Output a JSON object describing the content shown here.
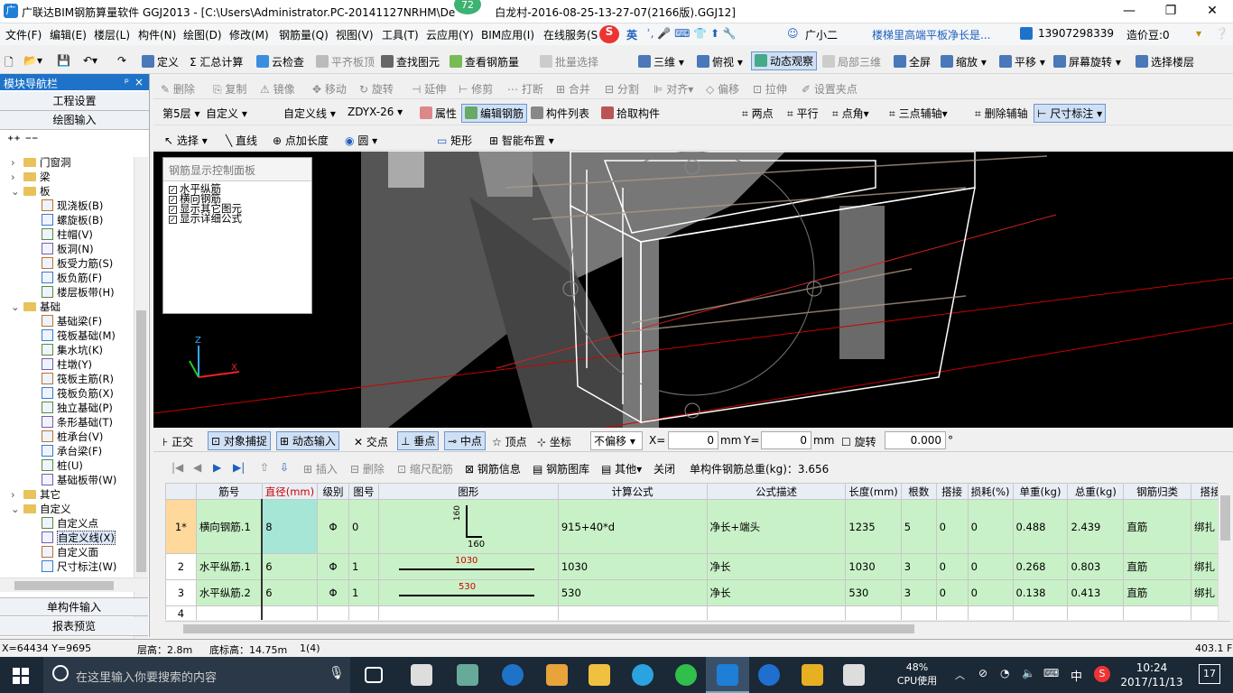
{
  "title": {
    "app": "广联达BIM钢筋算量软件 GGJ2013 - [C:\\Users\\Administrator.PC-20141127NRHM\\De",
    "file": "白龙村-2016-08-25-13-27-07(2166版).GGJ12]",
    "badge": "72"
  },
  "menu": [
    "文件(F)",
    "编辑(E)",
    "楼层(L)",
    "构件(N)",
    "绘图(D)",
    "修改(M)",
    "钢筋量(Q)",
    "视图(V)",
    "工具(T)",
    "云应用(Y)",
    "BIM应用(I)",
    "在线服务(S"
  ],
  "menu_right": {
    "ime": "英",
    "ime2": "广小二",
    "question": "楼梯里高端平板净长是...",
    "phone": "13907298339",
    "price": "造价豆:0"
  },
  "toolbar1": [
    "定义",
    "Σ 汇总计算",
    "云检查",
    "平齐板顶",
    "查找图元",
    "查看钢筋量",
    "批量选择",
    "三维",
    "俯视",
    "动态观察",
    "局部三维",
    "全屏",
    "缩放",
    "平移",
    "屏幕旋转",
    "选择楼层"
  ],
  "toolbar2": [
    "删除",
    "复制",
    "镜像",
    "移动",
    "旋转",
    "延伸",
    "修剪",
    "打断",
    "合并",
    "分割",
    "对齐",
    "偏移",
    "拉伸",
    "设置夹点"
  ],
  "toolbar3": {
    "floor": "第5层",
    "type": "自定义",
    "sub": "自定义线",
    "code": "ZDYX-26",
    "items": [
      "属性",
      "编辑钢筋",
      "构件列表",
      "拾取构件"
    ],
    "right": [
      "两点",
      "平行",
      "点角",
      "三点辅轴",
      "删除辅轴",
      "尺寸标注"
    ]
  },
  "toolbar4": [
    "选择",
    "直线",
    "点加长度",
    "圆",
    "矩形",
    "智能布置"
  ],
  "sidebar": {
    "header": "模块导航栏",
    "pin": "ᵖ",
    "close": "×",
    "btn1": "工程设置",
    "btn2": "绘图输入",
    "btn3": "单构件输入",
    "btn4": "报表预览"
  },
  "tree": [
    {
      "label": "门窗洞",
      "lvl": 1,
      "exp": "›"
    },
    {
      "label": "梁",
      "lvl": 1,
      "exp": "›"
    },
    {
      "label": "板",
      "lvl": 1,
      "exp": "⌄"
    },
    {
      "label": "现浇板(B)",
      "lvl": 2
    },
    {
      "label": "螺旋板(B)",
      "lvl": 2
    },
    {
      "label": "柱帽(V)",
      "lvl": 2
    },
    {
      "label": "板洞(N)",
      "lvl": 2
    },
    {
      "label": "板受力筋(S)",
      "lvl": 2
    },
    {
      "label": "板负筋(F)",
      "lvl": 2
    },
    {
      "label": "楼层板带(H)",
      "lvl": 2
    },
    {
      "label": "基础",
      "lvl": 1,
      "exp": "⌄"
    },
    {
      "label": "基础梁(F)",
      "lvl": 2
    },
    {
      "label": "筏板基础(M)",
      "lvl": 2
    },
    {
      "label": "集水坑(K)",
      "lvl": 2
    },
    {
      "label": "柱墩(Y)",
      "lvl": 2
    },
    {
      "label": "筏板主筋(R)",
      "lvl": 2
    },
    {
      "label": "筏板负筋(X)",
      "lvl": 2
    },
    {
      "label": "独立基础(P)",
      "lvl": 2
    },
    {
      "label": "条形基础(T)",
      "lvl": 2
    },
    {
      "label": "桩承台(V)",
      "lvl": 2
    },
    {
      "label": "承台梁(F)",
      "lvl": 2
    },
    {
      "label": "桩(U)",
      "lvl": 2
    },
    {
      "label": "基础板带(W)",
      "lvl": 2
    },
    {
      "label": "其它",
      "lvl": 1,
      "exp": "›"
    },
    {
      "label": "自定义",
      "lvl": 1,
      "exp": "⌄"
    },
    {
      "label": "自定义点",
      "lvl": 2
    },
    {
      "label": "自定义线(X)",
      "lvl": 2
    },
    {
      "label": "自定义面",
      "lvl": 2
    },
    {
      "label": "尺寸标注(W)",
      "lvl": 2
    }
  ],
  "panel": {
    "title": "钢筋显示控制面板",
    "opts": [
      "水平纵筋",
      "横向钢筋",
      "显示其它图元",
      "显示详细公式"
    ]
  },
  "snap": {
    "items": [
      "正交",
      "对象捕捉",
      "动态输入",
      "交点",
      "垂点",
      "中点",
      "顶点",
      "坐标"
    ],
    "offset": "不偏移",
    "x_label": "X=",
    "x": "0",
    "y_label": "Y=",
    "y": "0",
    "unit": "mm",
    "rotate": "旋转",
    "rot": "0.000",
    "deg": "°"
  },
  "gridbar": {
    "items": [
      "插入",
      "删除",
      "缩尺配筋",
      "钢筋信息",
      "钢筋图库",
      "其他",
      "关闭"
    ],
    "total": "单构件钢筋总重(kg)：3.656"
  },
  "table": {
    "headers": [
      "",
      "筋号",
      "直径(mm)",
      "级别",
      "图号",
      "图形",
      "计算公式",
      "公式描述",
      "长度(mm)",
      "根数",
      "搭接",
      "损耗(%)",
      "单重(kg)",
      "总重(kg)",
      "钢筋归类",
      "搭接"
    ],
    "rows": [
      {
        "no": "1*",
        "name": "横向钢筋.1",
        "d": "8",
        "grade": "Φ",
        "fig": "0",
        "shape": "160",
        "shape2": "160",
        "formula": "915+40*d",
        "desc": "净长+端头",
        "len": "1235",
        "n": "5",
        "lap": "0",
        "loss": "0",
        "uw": "0.488",
        "tw": "2.439",
        "cls": "直筋",
        "lt": "绑扎"
      },
      {
        "no": "2",
        "name": "水平纵筋.1",
        "d": "6",
        "grade": "Φ",
        "fig": "1",
        "shape": "1030",
        "formula": "1030",
        "desc": "净长",
        "len": "1030",
        "n": "3",
        "lap": "0",
        "loss": "0",
        "uw": "0.268",
        "tw": "0.803",
        "cls": "直筋",
        "lt": "绑扎"
      },
      {
        "no": "3",
        "name": "水平纵筋.2",
        "d": "6",
        "grade": "Φ",
        "fig": "1",
        "shape": "530",
        "formula": "530",
        "desc": "净长",
        "len": "530",
        "n": "3",
        "lap": "0",
        "loss": "0",
        "uw": "0.138",
        "tw": "0.413",
        "cls": "直筋",
        "lt": "绑扎"
      },
      {
        "no": "4",
        "name": "",
        "d": "",
        "grade": "",
        "fig": "",
        "shape": "",
        "formula": "",
        "desc": "",
        "len": "",
        "n": "",
        "lap": "",
        "loss": "",
        "uw": "",
        "tw": "",
        "cls": "",
        "lt": ""
      }
    ]
  },
  "status": {
    "coords": "X=64434 Y=9695",
    "floor_h": "层高：2.8m",
    "bottom": "底标高：14.75m",
    "page": "1(4)",
    "fps": "403.1 FPS"
  },
  "taskbar": {
    "search": "在这里输入你要搜索的内容",
    "cpu": "48%",
    "cpu_label": "CPU使用",
    "ime": "中",
    "time": "10:24",
    "date": "2017/11/13",
    "notif": "17"
  }
}
